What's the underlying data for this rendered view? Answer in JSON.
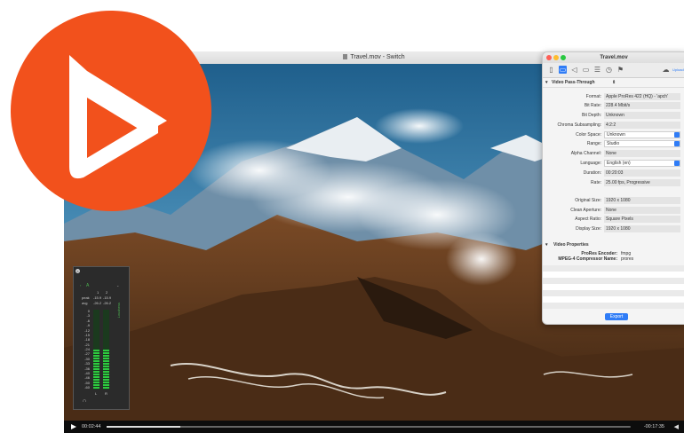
{
  "video_window": {
    "title": "Travel.mov - Switch",
    "time_elapsed": "00:02:44",
    "time_remaining": "-00:17:35"
  },
  "inspector": {
    "title": "Travel.mov",
    "section": "Video Pass-Through",
    "section_stepper": "⇕",
    "cloud_label": "Upload",
    "properties": [
      {
        "label": "Format:",
        "value": "Apple ProRes 422 (HQ) - 'apch'"
      },
      {
        "label": "Bit Rate:",
        "value": "228.4 Mbit/s"
      },
      {
        "label": "Bit Depth:",
        "value": "Unknown"
      },
      {
        "label": "Chroma Subsampling:",
        "value": "4:2:2"
      },
      {
        "label": "Color Space:",
        "value": "Unknown"
      },
      {
        "label": "Range:",
        "value": "Studio"
      },
      {
        "label": "Alpha Channel:",
        "value": "None"
      },
      {
        "label": "Language:",
        "value": "English (en)"
      },
      {
        "label": "Duration:",
        "value": "00:20:03"
      },
      {
        "label": "Rate:",
        "value": "25.00 fps, Progressive"
      },
      {
        "label": "Original Size:",
        "value": "1920 x 1080"
      },
      {
        "label": "Clean Aperture:",
        "value": "None"
      },
      {
        "label": "Aspect Ratio:",
        "value": "Square Pixels"
      },
      {
        "label": "Display Size:",
        "value": "1920 x 1080"
      }
    ],
    "video_properties_title": "Video Properties",
    "video_properties": [
      {
        "label": "ProRes Encoder:",
        "value": "fmpg"
      },
      {
        "label": "MPEG-4 Compressor Name:",
        "value": "prores"
      }
    ],
    "export_label": "Export"
  },
  "meter": {
    "channel_a": "A",
    "col1": "1",
    "col2": "2",
    "peak_label": "peak",
    "peak_1": "-15.9",
    "peak_2": "-15.9",
    "avg_label": "avg",
    "avg_1": "-26.2",
    "avg_2": "-26.2",
    "side_label": "Loudness",
    "scale": [
      "0",
      "-3",
      "-6",
      "-9",
      "-12",
      "-15",
      "-18",
      "-21",
      "-24",
      "-27",
      "-30",
      "-33",
      "-36",
      "-40",
      "-46",
      "-50",
      "-60"
    ],
    "left": "L",
    "right": "R",
    "level_left": 0.5,
    "level_right": 0.5
  },
  "colors": {
    "brand_orange": "#f2511c",
    "accent_blue": "#2f7cf6",
    "meter_green": "#2ecc40"
  }
}
